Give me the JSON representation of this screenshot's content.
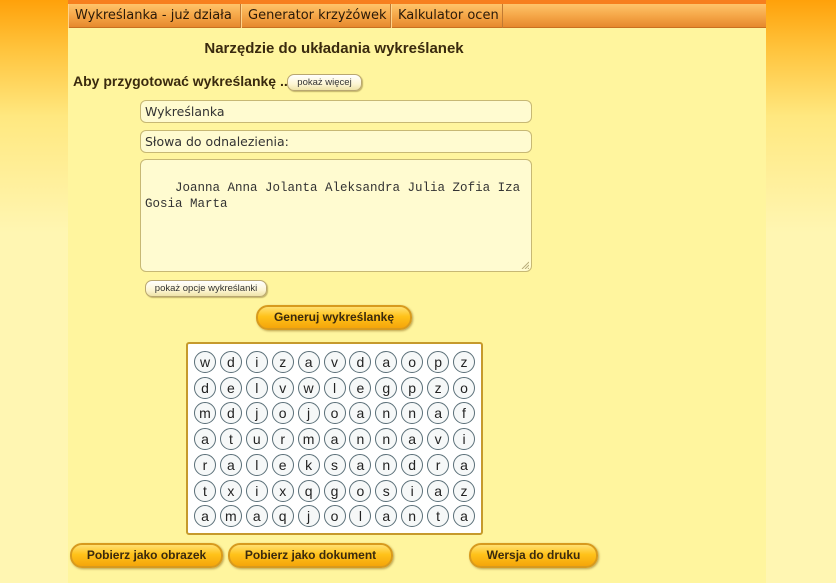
{
  "nav": {
    "items": [
      {
        "label": "Wykreślanka - już działa"
      },
      {
        "label": "Generator krzyżówek"
      },
      {
        "label": "Kalkulator ocen"
      }
    ]
  },
  "main": {
    "title": "Narzędzie do układania wykreślanek",
    "intro": "Aby przygotować wykreślankę ...",
    "show_more_label": "pokaż więcej",
    "title_field_value": "Wykreślanka",
    "words_heading_value": "Słowa do odnalezienia:",
    "words_value": "Joanna Anna Jolanta Aleksandra Julia Zofia Iza\nGosia Marta",
    "show_options_label": "pokaż opcje wykreślanki",
    "generate_label": "Generuj wykreślankę"
  },
  "puzzle": {
    "rows": [
      [
        "w",
        "d",
        "i",
        "z",
        "a",
        "v",
        "d",
        "a",
        "o",
        "p",
        "z"
      ],
      [
        "d",
        "e",
        "l",
        "v",
        "w",
        "l",
        "e",
        "g",
        "p",
        "z",
        "o"
      ],
      [
        "m",
        "d",
        "j",
        "o",
        "j",
        "o",
        "a",
        "n",
        "n",
        "a",
        "f"
      ],
      [
        "a",
        "t",
        "u",
        "r",
        "m",
        "a",
        "n",
        "n",
        "a",
        "v",
        "i"
      ],
      [
        "r",
        "a",
        "l",
        "e",
        "k",
        "s",
        "a",
        "n",
        "d",
        "r",
        "a"
      ],
      [
        "t",
        "x",
        "i",
        "x",
        "q",
        "g",
        "o",
        "s",
        "i",
        "a",
        "z"
      ],
      [
        "a",
        "m",
        "a",
        "q",
        "j",
        "o",
        "l",
        "a",
        "n",
        "t",
        "a"
      ]
    ]
  },
  "footer": {
    "download_image_label": "Pobierz jako obrazek",
    "download_document_label": "Pobierz jako dokument",
    "print_version_label": "Wersja do druku"
  }
}
